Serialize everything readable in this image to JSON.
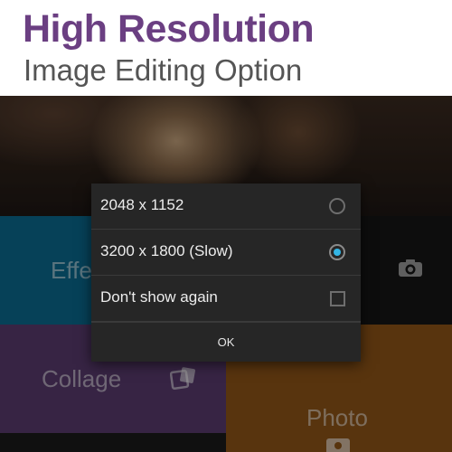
{
  "promo": {
    "headline": "High Resolution",
    "subheadline": "Image Editing Option"
  },
  "tiles": {
    "effects_label": "Effe",
    "collage_label": "Collage",
    "photo_label": "Photo"
  },
  "dialog": {
    "options": [
      {
        "label": "2048 x 1152",
        "selected": false
      },
      {
        "label": "3200 x 1800 (Slow)",
        "selected": true
      }
    ],
    "dont_show_label": "Don't show again",
    "dont_show_checked": false,
    "ok_label": "OK"
  },
  "colors": {
    "headline": "#6b3f82",
    "accent": "#33b5e5",
    "effects_tile": "#0a6a8f",
    "collage_tile": "#5a3b6e",
    "photo_tile": "#8e5418"
  }
}
